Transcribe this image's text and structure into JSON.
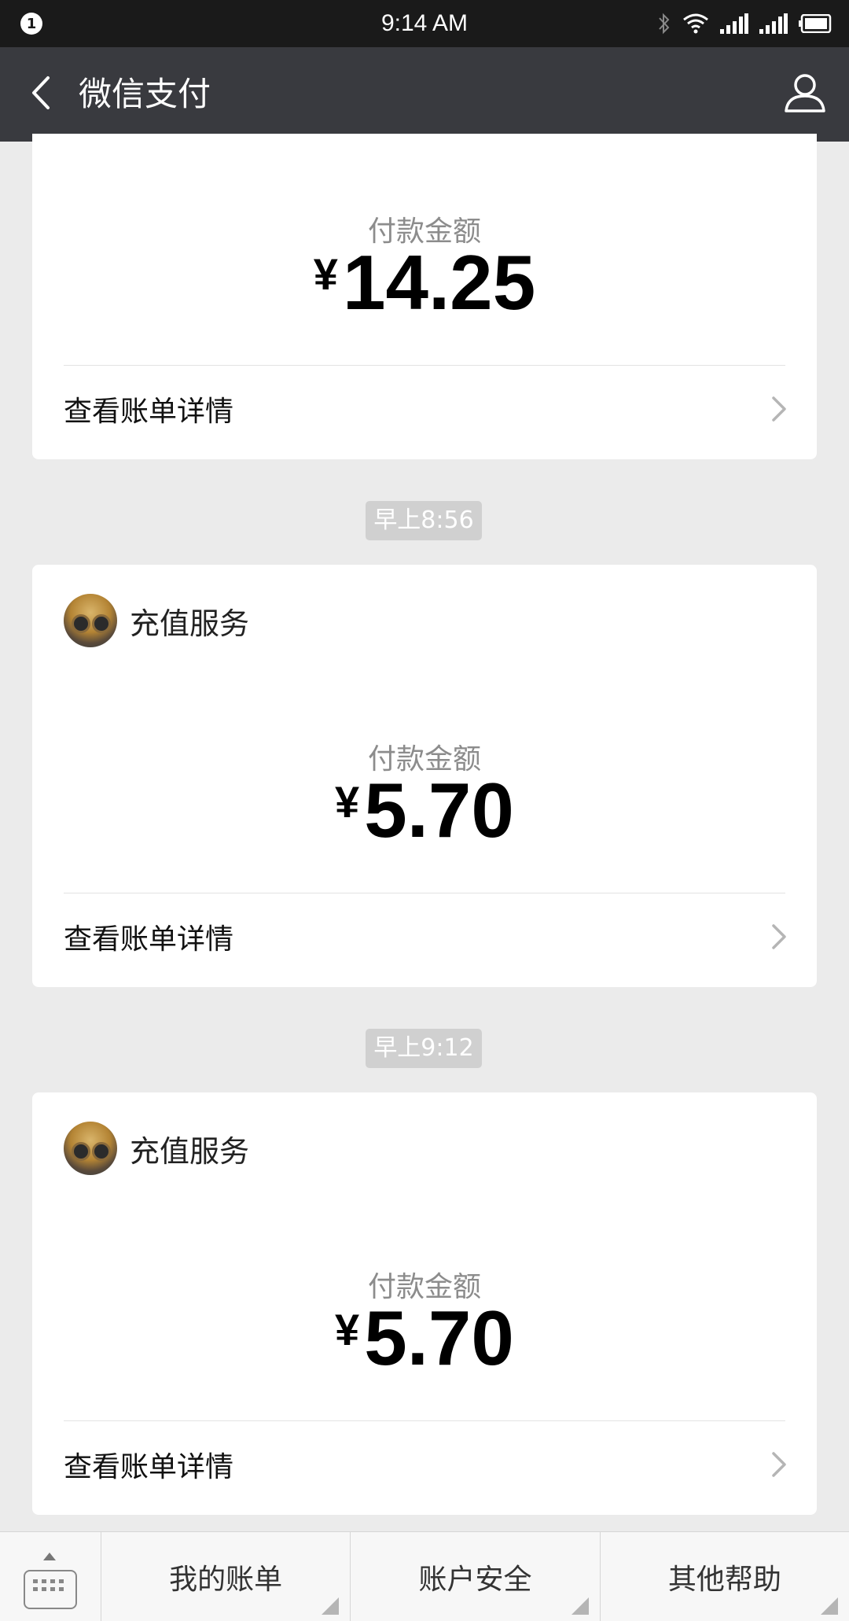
{
  "status_bar": {
    "notification_count": "1",
    "time": "9:14 AM",
    "icons": [
      "bluetooth-icon",
      "wifi-icon",
      "signal-1-icon",
      "signal-2-icon",
      "battery-icon"
    ]
  },
  "header": {
    "title": "微信支付",
    "back_icon": "chevron-left-icon",
    "profile_icon": "person-icon"
  },
  "messages": [
    {
      "merchant": "",
      "amount_label": "付款金额",
      "currency": "¥",
      "amount": "14.25",
      "detail_link": "查看账单详情"
    },
    {
      "timestamp": "早上8:56",
      "merchant": "充值服务",
      "amount_label": "付款金额",
      "currency": "¥",
      "amount": "5.70",
      "detail_link": "查看账单详情"
    },
    {
      "timestamp": "早上9:12",
      "merchant": "充值服务",
      "amount_label": "付款金额",
      "currency": "¥",
      "amount": "5.70",
      "detail_link": "查看账单详情"
    }
  ],
  "bottom_menu": {
    "keyboard_icon": "keyboard-icon",
    "items": [
      {
        "label": "我的账单"
      },
      {
        "label": "账户安全"
      },
      {
        "label": "其他帮助"
      }
    ]
  },
  "colors": {
    "status_bar_bg": "#1a1a1a",
    "header_bg": "#393a3f",
    "page_bg": "#ebebeb",
    "card_bg": "#ffffff",
    "timestamp_bg": "#d0d0d0"
  }
}
